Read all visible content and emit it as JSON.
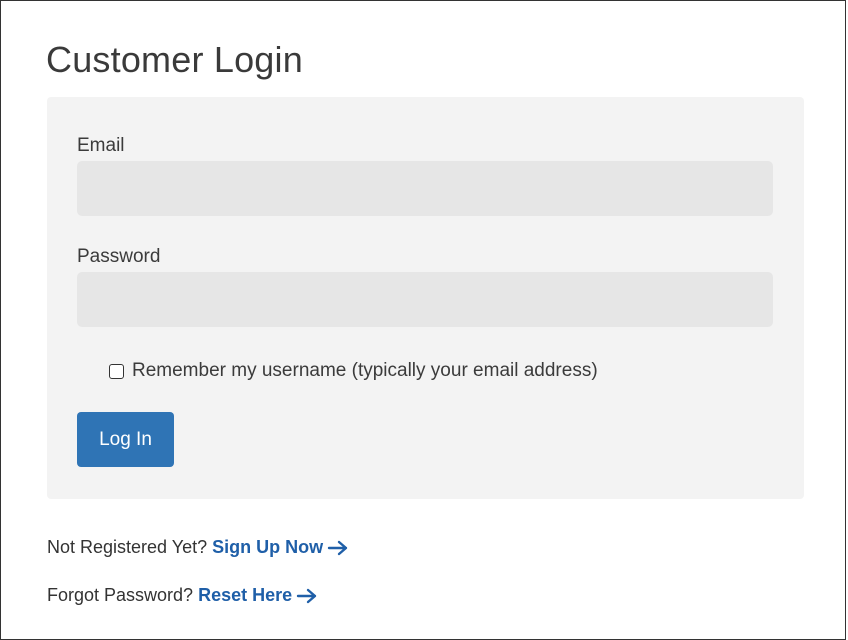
{
  "page": {
    "title": "Customer Login"
  },
  "form": {
    "email_label": "Email",
    "email_value": "",
    "password_label": "Password",
    "password_value": "",
    "remember_label": "Remember my username (typically your email address)",
    "remember_checked": false,
    "login_button_label": "Log In"
  },
  "footer": {
    "signup_prompt": "Not Registered Yet?",
    "signup_link": "Sign Up Now",
    "reset_prompt": "Forgot Password?",
    "reset_link": "Reset Here"
  },
  "icons": {
    "arrow": "arrow-right-icon"
  },
  "colors": {
    "accent": "#2f74b5",
    "link": "#1f5fa8",
    "panel_bg": "#f3f3f3",
    "input_bg": "#e6e6e6"
  }
}
